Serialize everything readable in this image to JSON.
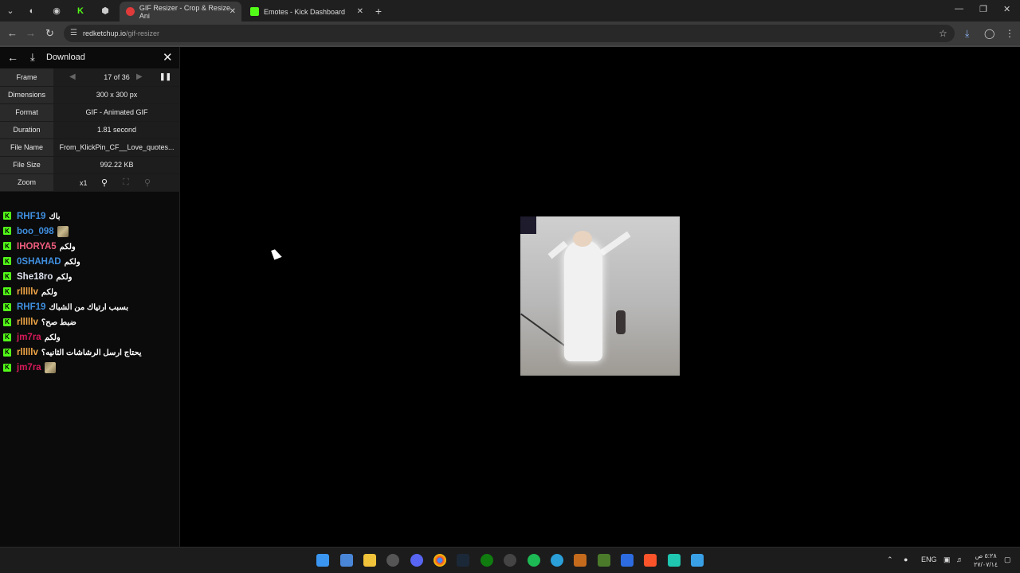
{
  "browser": {
    "tabs": [
      {
        "label": "GIF Resizer - Crop & Resize Ani",
        "active": true
      },
      {
        "label": "Emotes - Kick Dashboard",
        "active": false
      }
    ],
    "url_host": "redketchup.io",
    "url_path": "/gif-resizer"
  },
  "panel": {
    "header": "Download",
    "rows": {
      "frame": {
        "label": "Frame",
        "value": "17 of 36"
      },
      "dimensions": {
        "label": "Dimensions",
        "value": "300 x 300 px"
      },
      "format": {
        "label": "Format",
        "value": "GIF - Animated GIF"
      },
      "duration": {
        "label": "Duration",
        "value": "1.81 second"
      },
      "filename": {
        "label": "File Name",
        "value": "From_KlickPin_CF__Love_quotes..."
      },
      "filesize": {
        "label": "File Size",
        "value": "992.22 KB"
      },
      "zoom": {
        "label": "Zoom",
        "value": "x1"
      }
    }
  },
  "chat": [
    {
      "user": "RHF19",
      "color": "#3f8fe0",
      "text": "باك",
      "emote": false
    },
    {
      "user": "boo_098",
      "color": "#3f8fe0",
      "text": "",
      "emote": true
    },
    {
      "user": "IHORYA5",
      "color": "#ee5c7c",
      "text": "ولكم",
      "emote": false
    },
    {
      "user": "0SHAHAD",
      "color": "#3f8fe0",
      "text": "ولكم",
      "emote": false
    },
    {
      "user": "She18ro",
      "color": "#dfe3ef",
      "text": "ولكم",
      "emote": false
    },
    {
      "user": "rlllllv",
      "color": "#f2a646",
      "text": "ولكم",
      "emote": false
    },
    {
      "user": "RHF19",
      "color": "#3f8fe0",
      "text": "بسبب ارتياك من الشباك",
      "emote": false
    },
    {
      "user": "rlllllv",
      "color": "#f2a646",
      "text": "ضبط صح؟",
      "emote": false
    },
    {
      "user": "jm7ra",
      "color": "#d81a5a",
      "text": "ولكم",
      "emote": false
    },
    {
      "user": "rlllllv",
      "color": "#f2a646",
      "text": "يحتاج ارسل الرشاشات الثانيه؟",
      "emote": false
    },
    {
      "user": "jm7ra",
      "color": "#d81a5a",
      "text": "",
      "emote": true
    }
  ],
  "taskbar": {
    "lang": "ENG",
    "clock_time": "٥:٢٨ ص",
    "clock_date": "٢٧/٠٧/١٤"
  }
}
